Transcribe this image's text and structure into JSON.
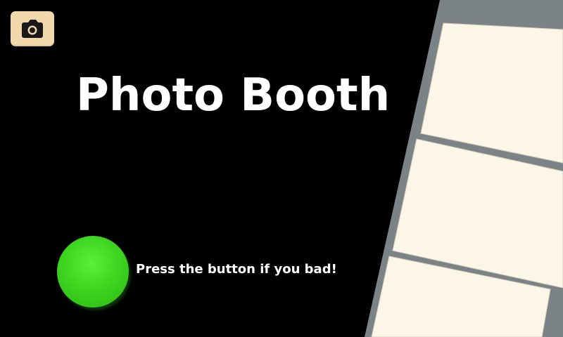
{
  "app": {
    "title": "Photo Booth",
    "icon": "camera-icon",
    "icon_color": "#f3d8ab"
  },
  "shutter": {
    "hint": "Press the button if you bad!",
    "button_color": "#3ed621"
  },
  "photo_strip": {
    "frames": 3,
    "frame_color": "#fbf6e8",
    "strip_color": "#7a8286"
  }
}
